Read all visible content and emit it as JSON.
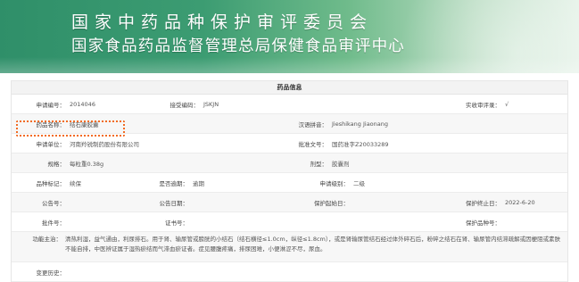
{
  "banner": {
    "title_line1": "国家中药品种保护审评委员会",
    "title_line2": "国家食品药品监督管理总局保健食品审评中心"
  },
  "section": {
    "title": "药品信息"
  },
  "fields": {
    "application_no": {
      "label": "申请编号：",
      "value": "2014046"
    },
    "acceptance_no": {
      "label": "接受编码：",
      "value": "JSKJN"
    },
    "production_review": {
      "label": "实收审评录：",
      "value": "√"
    },
    "drug_name": {
      "label": "药品名称：",
      "value": "结石康胶囊"
    },
    "pinyin": {
      "label": "汉语拼音：",
      "value": "Jieshikang Jiaonang"
    },
    "applicant": {
      "label": "申请单位：",
      "value": "河南羚锐制药股份有限公司"
    },
    "approval_no": {
      "label": "批准文号：",
      "value": "国药准字Z20033289"
    },
    "spec": {
      "label": "规格：",
      "value": "每粒重0.38g"
    },
    "dosage_form": {
      "label": "剂型：",
      "value": "胶囊剂"
    },
    "category": {
      "label": "品种标记：",
      "value": "续保"
    },
    "overdue": {
      "label": "是否逾期：",
      "value": "逾期"
    },
    "level": {
      "label": "申请级别：",
      "value": "二级"
    },
    "announcement_no": {
      "label": "公告号：",
      "value": ""
    },
    "announcement_date": {
      "label": "公告日期：",
      "value": ""
    },
    "protection_start": {
      "label": "保护起始日：",
      "value": ""
    },
    "protection_end": {
      "label": "保护终止日：",
      "value": "2022-6-20"
    },
    "batch_no": {
      "label": "批件号：",
      "value": ""
    },
    "certificate_no": {
      "label": "证书号：",
      "value": ""
    },
    "protection_no": {
      "label": "保护品种号：",
      "value": ""
    },
    "indications": {
      "label": "功能主治：",
      "value": "清热利湿，益气通由，利尿排石。用于肾、输尿管或膀胱的小结石（结石横径≤1.0cm，纵径≤1.8cm），或是肾输尿管结石经过体外碎石后，粉碎之结石在肾、输尿管内结滞疏解或因梗阻或素肤不能自排，中医辨证属于湿热瘀结而气滞血瘀证者。症见腰腹疼痛，排尿困难，小便淋涩不尽，尿血。"
    },
    "change_history": {
      "label": "变更历史：",
      "value": ""
    }
  },
  "colors": {
    "banner_green": "#3c9c72",
    "highlight_orange": "#f26b22",
    "header_bg": "#f3f3f3",
    "alt_row_bg": "#f7f7f7"
  }
}
